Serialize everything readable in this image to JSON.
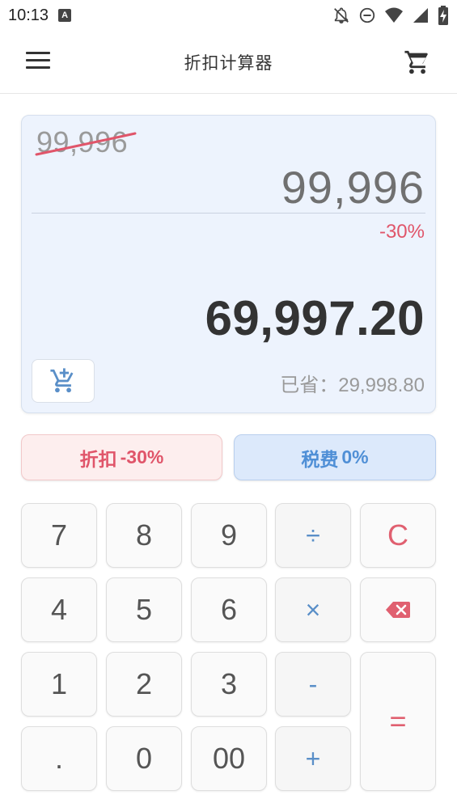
{
  "status_bar": {
    "time": "10:13",
    "app_icon_letter": "A",
    "icons": [
      "notifications-off-icon",
      "do-not-disturb-icon",
      "wifi-icon",
      "signal-icon",
      "battery-charging-icon"
    ]
  },
  "app_bar": {
    "title": "折扣计算器",
    "menu_icon": "menu-icon",
    "cart_icon": "cart-icon"
  },
  "display": {
    "original_price": "99,996",
    "input_value": "99,996",
    "discount_label": "-30%",
    "result_value": "69,997.20",
    "saved_label": "已省：",
    "saved_value": "29,998.80",
    "add_to_cart_icon": "add-to-cart-icon",
    "strike_color": "#e0556a"
  },
  "buttons": {
    "discount_label": "折扣",
    "discount_value": "-30%",
    "tax_label": "税费",
    "tax_value": "0%"
  },
  "keypad": {
    "k7": "7",
    "k8": "8",
    "k9": "9",
    "divide": "÷",
    "clear": "C",
    "k4": "4",
    "k5": "5",
    "k6": "6",
    "multiply": "×",
    "k1": "1",
    "k2": "2",
    "k3": "3",
    "minus": "-",
    "equals": "=",
    "dot": ".",
    "k0": "0",
    "k00": "00",
    "plus": "+",
    "backspace_icon": "backspace-icon"
  },
  "colors": {
    "accent_red": "#e0556a",
    "accent_blue": "#4f8fd6",
    "display_bg": "#edf3fd"
  }
}
